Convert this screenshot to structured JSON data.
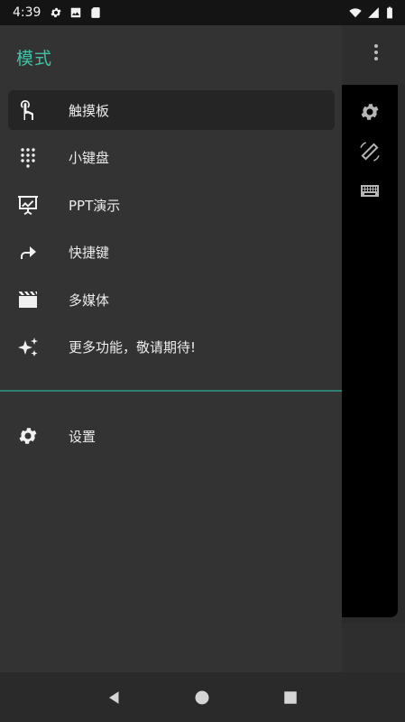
{
  "status_bar": {
    "time": "4:39",
    "left_icons": [
      "gear-icon",
      "image-icon",
      "sd-card-icon"
    ],
    "right_icons": [
      "wifi-icon",
      "signal-icon",
      "battery-icon"
    ]
  },
  "drawer": {
    "title": "模式",
    "items": [
      {
        "label": "触摸板",
        "icon": "touchpad-gesture-icon",
        "active": true
      },
      {
        "label": "小键盘",
        "icon": "dialpad-icon",
        "active": false
      },
      {
        "label": "PPT演示",
        "icon": "presentation-icon",
        "active": false
      },
      {
        "label": "快捷键",
        "icon": "shortcut-arrow-icon",
        "active": false
      },
      {
        "label": "多媒体",
        "icon": "clapperboard-icon",
        "active": false
      },
      {
        "label": "更多功能，敬请期待!",
        "icon": "sparkles-icon",
        "active": false
      }
    ],
    "settings_label": "设置",
    "accent_color": "#3fc3a7"
  },
  "app": {
    "side_tools": [
      "settings-icon",
      "screen-rotation-icon",
      "keyboard-icon"
    ]
  },
  "nav_bar": {
    "buttons": [
      "back-icon",
      "home-icon",
      "recents-icon"
    ]
  }
}
